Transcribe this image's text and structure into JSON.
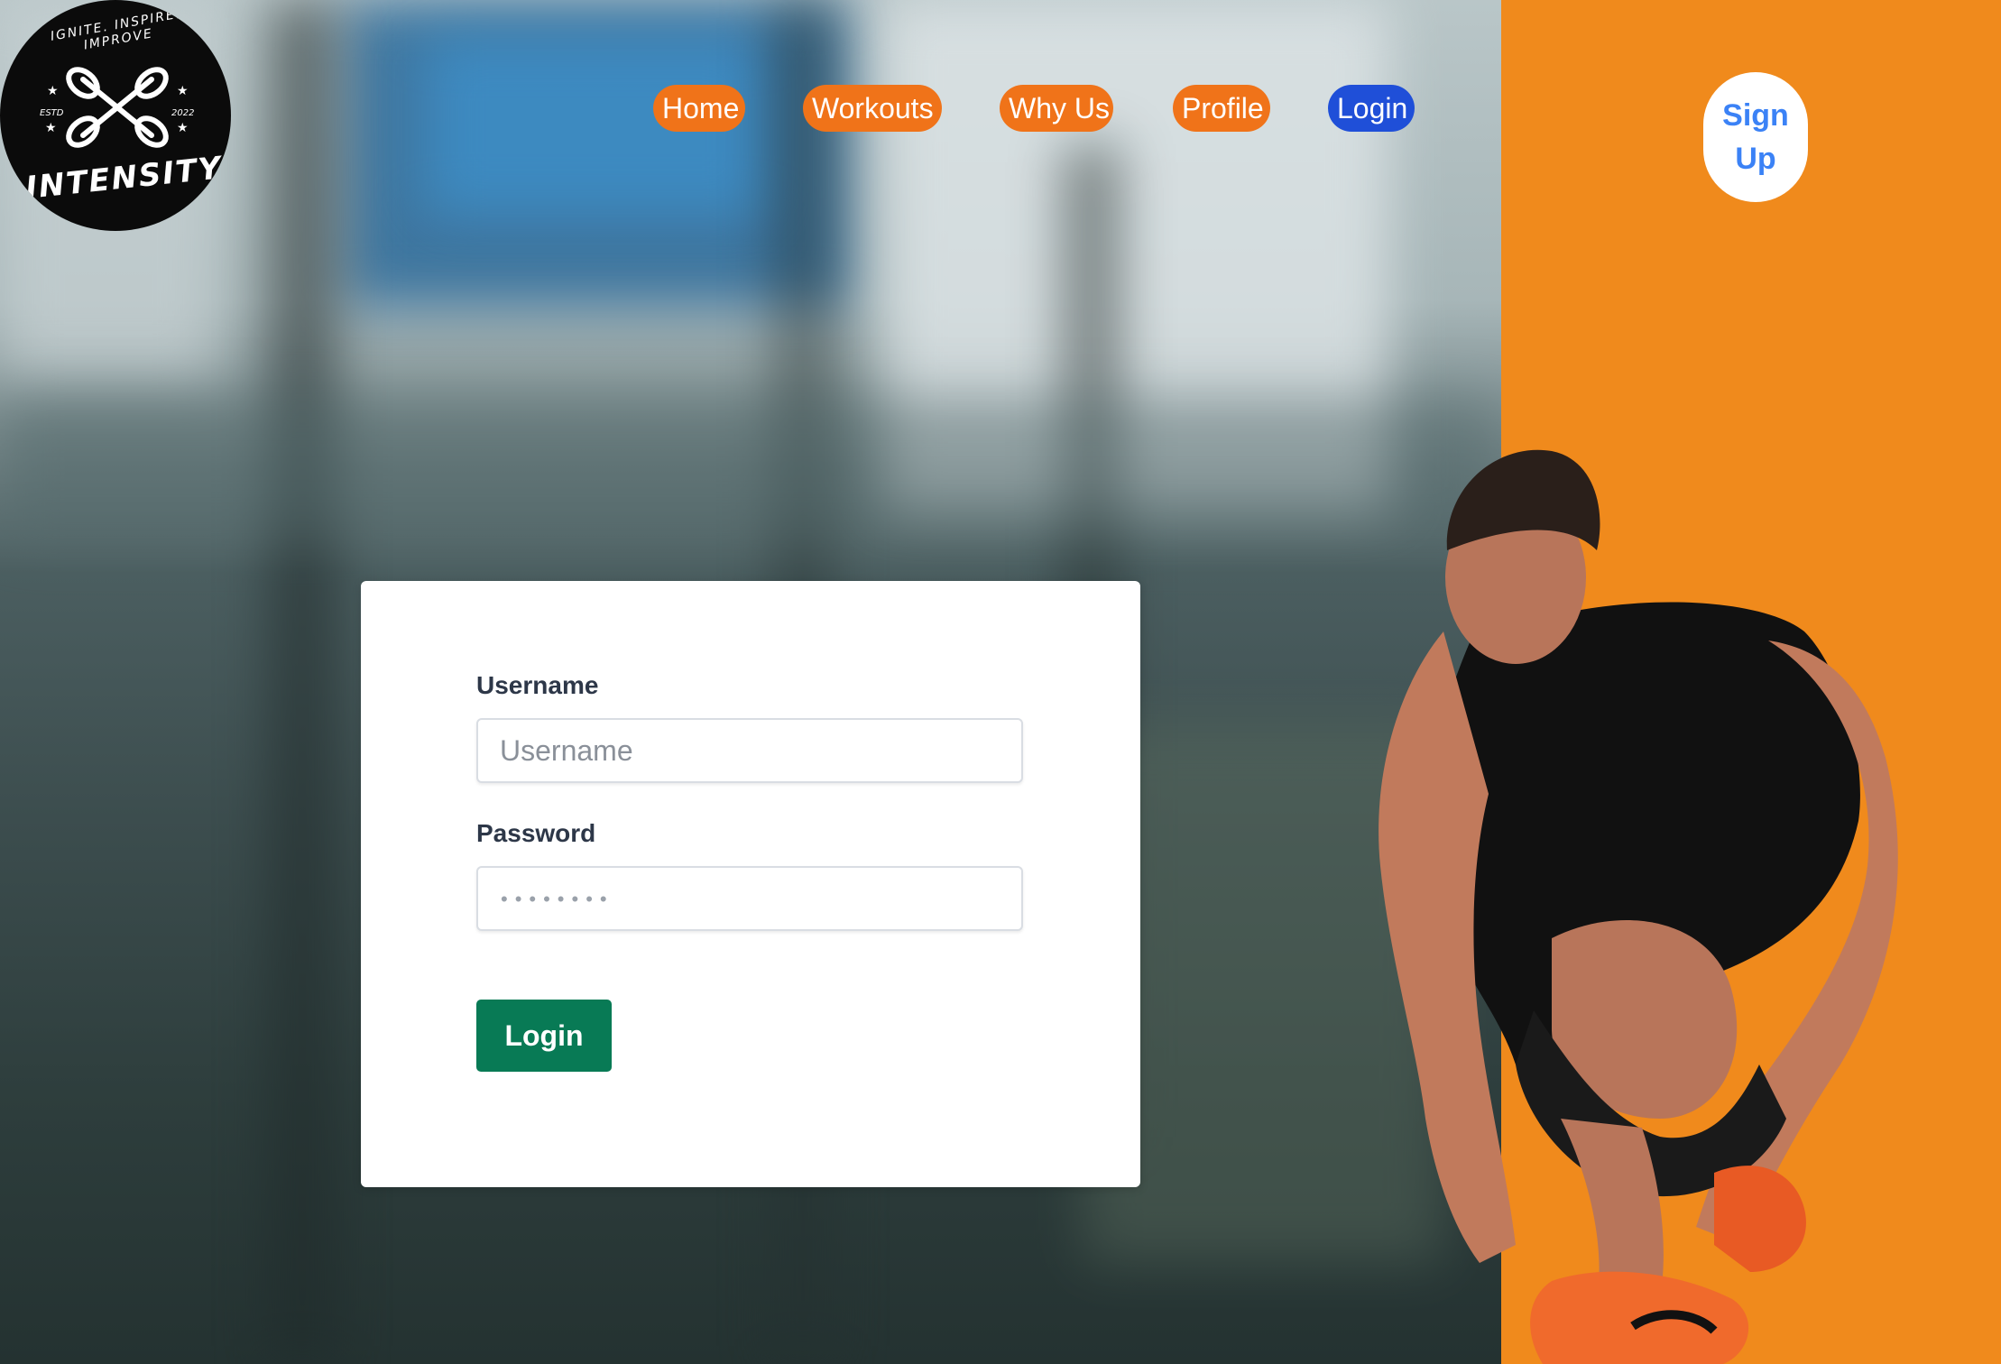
{
  "brand": {
    "name": "INTENSITY",
    "motto": "IGNITE. INSPIRE. IMPROVE",
    "estd_label": "ESTD",
    "estd_year": "2022"
  },
  "nav": {
    "items": [
      {
        "label": "Home"
      },
      {
        "label": "Workouts"
      },
      {
        "label": "Why Us"
      },
      {
        "label": "Profile"
      },
      {
        "label": "Login"
      }
    ],
    "signup_line1": "Sign",
    "signup_line2": "Up"
  },
  "login_form": {
    "username_label": "Username",
    "username_placeholder": "Username",
    "password_label": "Password",
    "password_value": "••••••••",
    "submit_label": "Login"
  },
  "colors": {
    "orange_panel": "#f08a1c",
    "nav_pill": "#f07319",
    "nav_active": "#1f4fd8",
    "login_button": "#087a55",
    "signup_text": "#3b82f6"
  }
}
